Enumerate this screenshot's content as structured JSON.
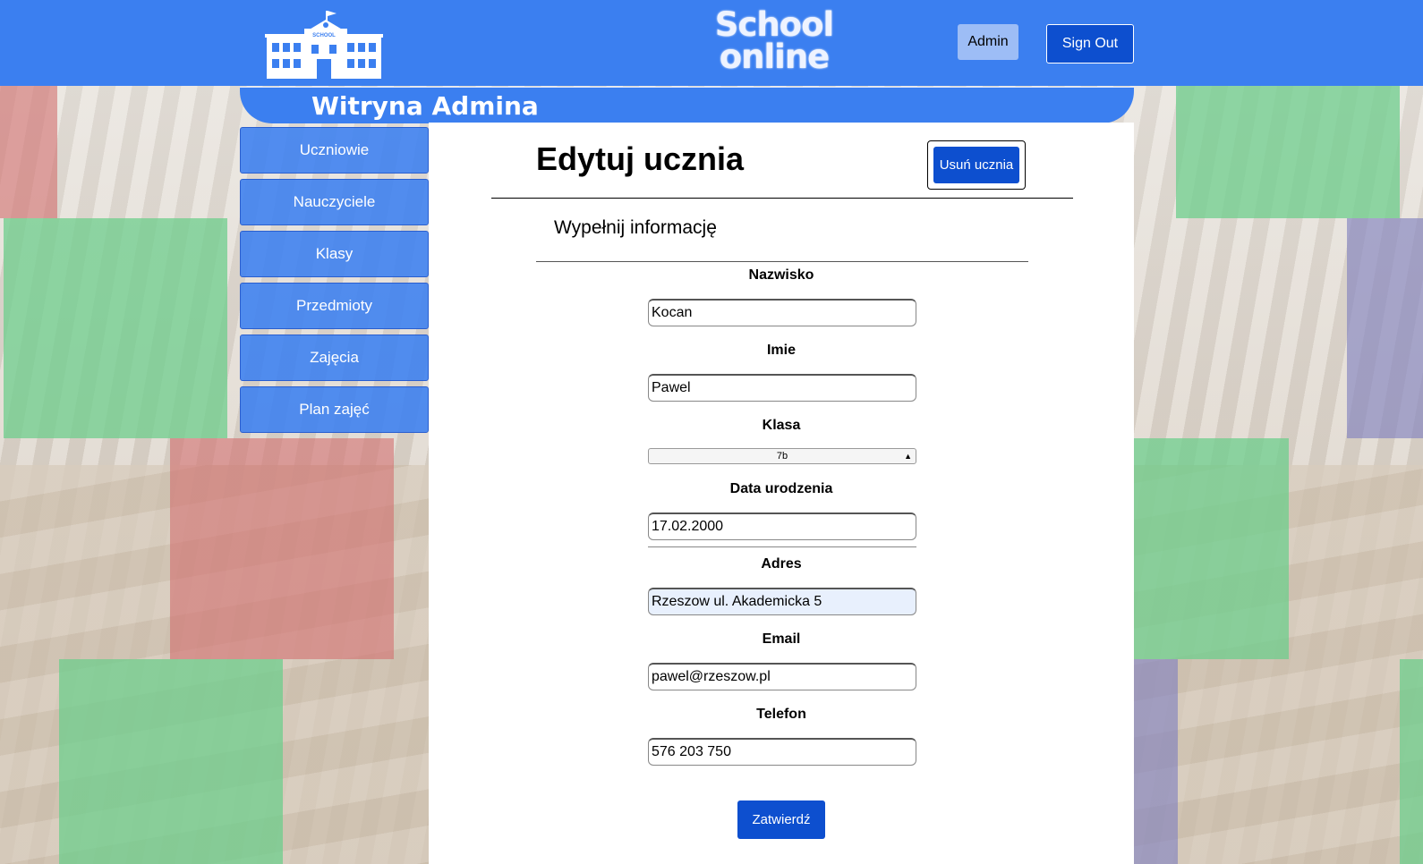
{
  "header": {
    "brand_line1": "School",
    "brand_line2": "online",
    "logo_sign": "SCHOOL",
    "admin_label": "Admin",
    "signout_label": "Sign Out"
  },
  "subheader": {
    "title": "Witryna Admina"
  },
  "sidebar": {
    "items": [
      {
        "label": "Uczniowie"
      },
      {
        "label": "Nauczyciele"
      },
      {
        "label": "Klasy"
      },
      {
        "label": "Przedmioty"
      },
      {
        "label": "Zajęcia"
      },
      {
        "label": "Plan zajęć"
      }
    ]
  },
  "main": {
    "title": "Edytuj ucznia",
    "delete_label": "Usuń ucznia",
    "subtitle": "Wypełnij informację",
    "fields": {
      "surname": {
        "label": "Nazwisko",
        "value": "Kocan"
      },
      "name": {
        "label": "Imie",
        "value": "Pawel"
      },
      "class": {
        "label": "Klasa",
        "value": "7b"
      },
      "birthdate": {
        "label": "Data urodzenia",
        "value": "17.02.2000"
      },
      "address": {
        "label": "Adres",
        "value": "Rzeszow ul. Akademicka 5"
      },
      "email": {
        "label": "Email",
        "value": "pawel@rzeszow.pl"
      },
      "phone": {
        "label": "Telefon",
        "value": "576 203 750"
      }
    },
    "submit_label": "Zatwierdź"
  },
  "colors": {
    "primary": "#3b7ff0",
    "button_dark": "#0d4fcf",
    "admin_button": "#9dbdf6"
  }
}
